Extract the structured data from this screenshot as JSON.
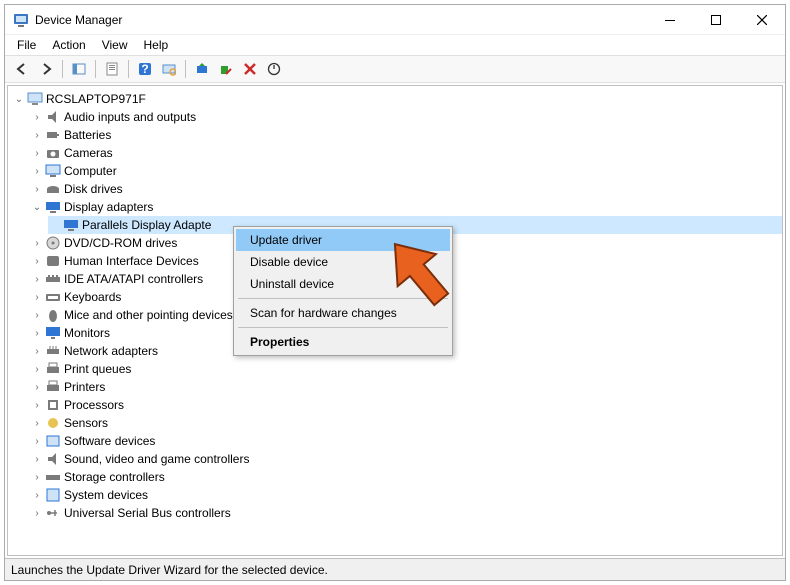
{
  "window": {
    "title": "Device Manager"
  },
  "menu": {
    "file": "File",
    "action": "Action",
    "view": "View",
    "help": "Help"
  },
  "tree": {
    "root": "RCSLAPTOP971F",
    "nodes": [
      "Audio inputs and outputs",
      "Batteries",
      "Cameras",
      "Computer",
      "Disk drives",
      "Display adapters",
      "DVD/CD-ROM drives",
      "Human Interface Devices",
      "IDE ATA/ATAPI controllers",
      "Keyboards",
      "Mice and other pointing devices",
      "Monitors",
      "Network adapters",
      "Print queues",
      "Printers",
      "Processors",
      "Sensors",
      "Software devices",
      "Sound, video and game controllers",
      "Storage controllers",
      "System devices",
      "Universal Serial Bus controllers"
    ],
    "display_child": "Parallels Display Adapte"
  },
  "context_menu": {
    "update": "Update driver",
    "disable": "Disable device",
    "uninstall": "Uninstall device",
    "scan": "Scan for hardware changes",
    "properties": "Properties"
  },
  "status": "Launches the Update Driver Wizard for the selected device.",
  "icons": {
    "app": "device-manager-icon",
    "arrow_back": "back-icon",
    "arrow_fwd": "forward-icon"
  }
}
